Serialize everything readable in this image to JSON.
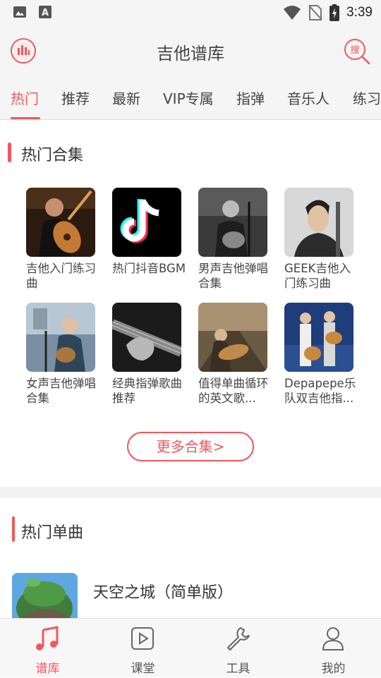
{
  "status_bar": {
    "time": "3:39",
    "icons": [
      "image-icon",
      "a-keyboard-icon",
      "wifi-icon",
      "no-sim-icon",
      "battery-icon"
    ]
  },
  "header": {
    "title": "吉他谱库",
    "left_icon": "equalizer-icon",
    "right_icon": "search-icon",
    "search_glyph": "搜"
  },
  "tabs": [
    {
      "label": "热门",
      "active": true
    },
    {
      "label": "推荐"
    },
    {
      "label": "最新"
    },
    {
      "label": "VIP专属"
    },
    {
      "label": "指弹"
    },
    {
      "label": "音乐人"
    },
    {
      "label": "练习"
    }
  ],
  "hot_collections": {
    "title": "热门合集",
    "items": [
      {
        "label": "吉他入门练习曲"
      },
      {
        "label": "热门抖音BGM"
      },
      {
        "label": "男声吉他弹唱合集"
      },
      {
        "label": "GEEK吉他入门练习曲"
      },
      {
        "label": "女声吉他弹唱合集"
      },
      {
        "label": "经典指弹歌曲推荐"
      },
      {
        "label": "值得单曲循环的英文歌..."
      },
      {
        "label": "Depapepe乐队双吉他指..."
      }
    ],
    "more_label": "更多合集>"
  },
  "hot_singles": {
    "title": "热门单曲",
    "items": [
      {
        "title": "天空之城（简单版）"
      }
    ]
  },
  "bottom_nav": [
    {
      "label": "谱库",
      "icon": "music-note-icon",
      "active": true
    },
    {
      "label": "课堂",
      "icon": "play-video-icon"
    },
    {
      "label": "工具",
      "icon": "wrench-icon"
    },
    {
      "label": "我的",
      "icon": "person-icon"
    }
  ],
  "colors": {
    "accent": "#f0585c",
    "bar_bg": "#f5f5f5",
    "text": "#333333"
  }
}
